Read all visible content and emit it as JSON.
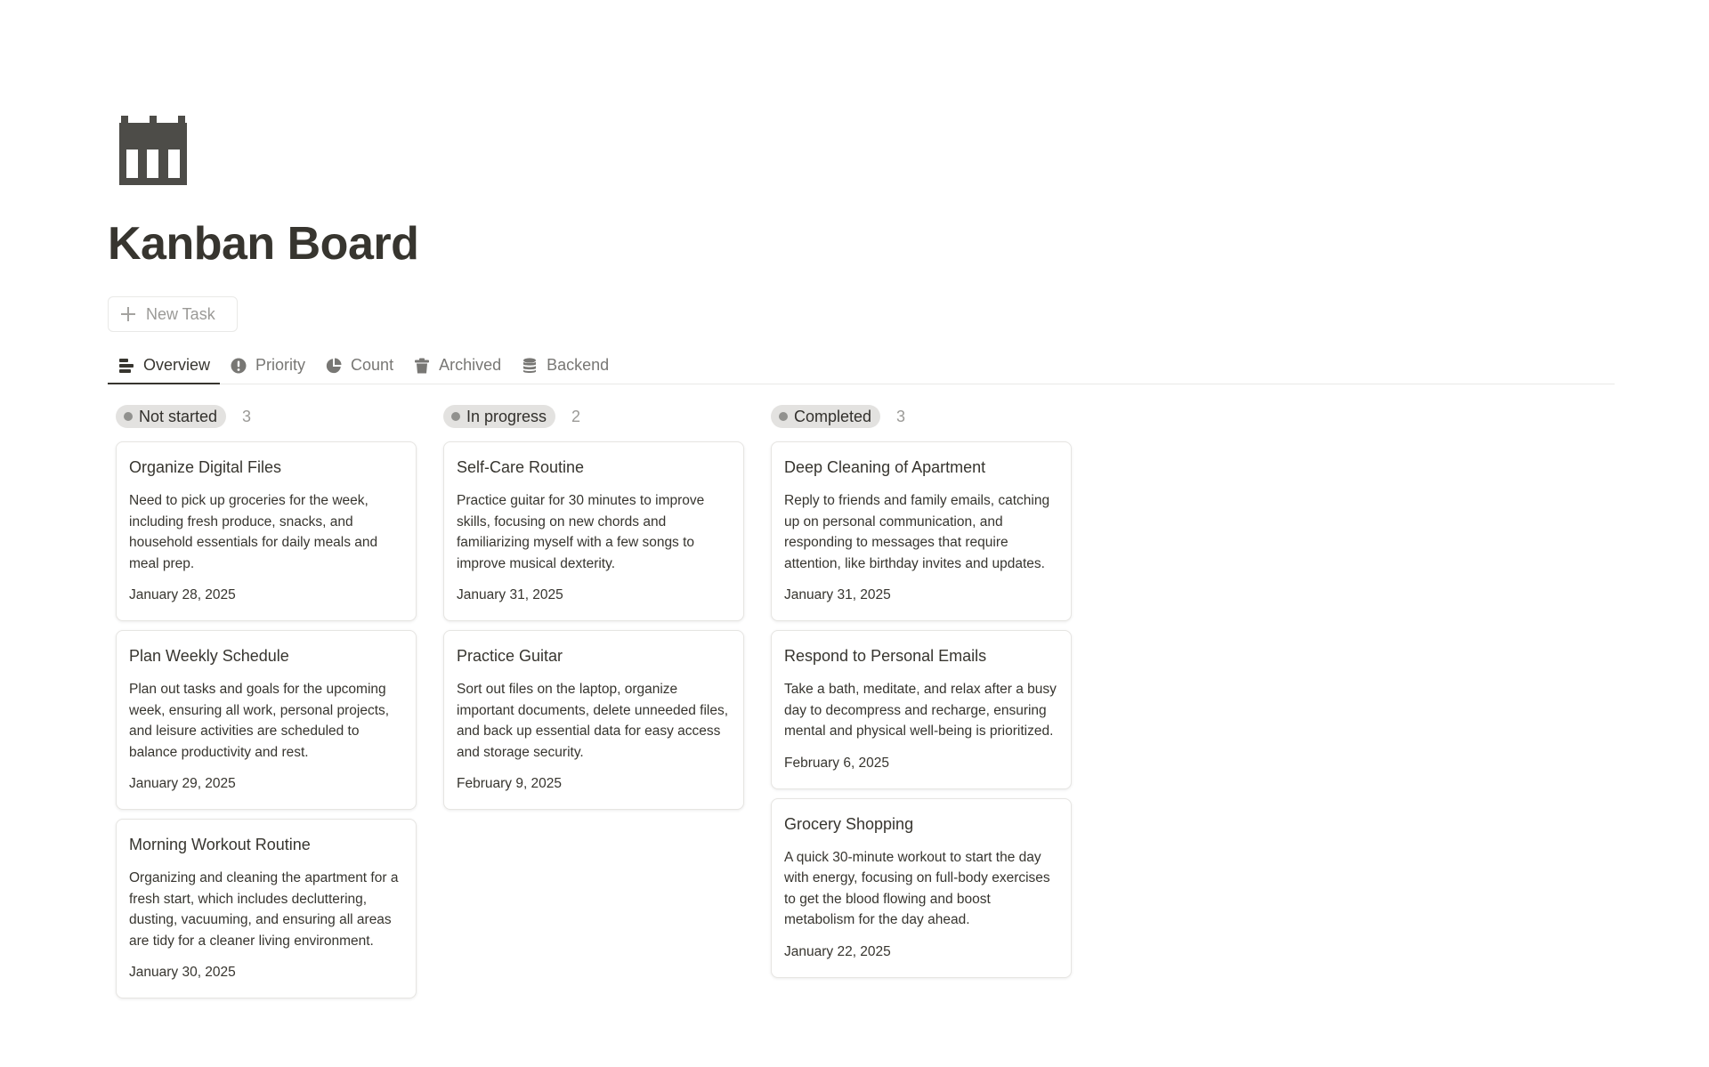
{
  "page": {
    "title": "Kanban Board",
    "icon": "calendar-icon"
  },
  "toolbar": {
    "new_task_label": "New Task"
  },
  "tabs": [
    {
      "label": "Overview",
      "icon": "list-layout-icon",
      "active": true
    },
    {
      "label": "Priority",
      "icon": "alert-circle-icon",
      "active": false
    },
    {
      "label": "Count",
      "icon": "pie-chart-icon",
      "active": false
    },
    {
      "label": "Archived",
      "icon": "trash-icon",
      "active": false
    },
    {
      "label": "Backend",
      "icon": "database-icon",
      "active": false
    }
  ],
  "columns": [
    {
      "status": "Not started",
      "count": "3",
      "cards": [
        {
          "title": "Organize Digital Files",
          "description": "Need to pick up groceries for the week, including fresh produce, snacks, and household essentials for daily meals and meal prep.",
          "date": "January 28, 2025"
        },
        {
          "title": "Plan Weekly Schedule",
          "description": "Plan out tasks and goals for the upcoming week, ensuring all work, personal projects, and leisure activities are scheduled to balance productivity and rest.",
          "date": "January 29, 2025"
        },
        {
          "title": "Morning Workout Routine",
          "description": "Organizing and cleaning the apartment for a fresh start, which includes decluttering, dusting, vacuuming, and ensuring all areas are tidy for a cleaner living environment.",
          "date": "January 30, 2025"
        }
      ]
    },
    {
      "status": "In progress",
      "count": "2",
      "cards": [
        {
          "title": "Self-Care Routine",
          "description": "Practice guitar for 30 minutes to improve skills, focusing on new chords and familiarizing myself with a few songs to improve musical dexterity.",
          "date": "January 31, 2025"
        },
        {
          "title": "Practice Guitar",
          "description": "Sort out files on the laptop, organize important documents, delete unneeded files, and back up essential data for easy access and storage security.",
          "date": "February 9, 2025"
        }
      ]
    },
    {
      "status": "Completed",
      "count": "3",
      "cards": [
        {
          "title": "Deep Cleaning of Apartment",
          "description": "Reply to friends and family emails, catching up on personal communication, and responding to messages that require attention, like birthday invites and updates.",
          "date": "January 31, 2025"
        },
        {
          "title": "Respond to Personal Emails",
          "description": "Take a bath, meditate, and relax after a busy day to decompress and recharge, ensuring mental and physical well-being is prioritized.",
          "date": "February 6, 2025"
        },
        {
          "title": "Grocery Shopping",
          "description": "A quick 30-minute workout to start the day with energy, focusing on full-body exercises to get the blood flowing and boost metabolism for the day ahead.",
          "date": "January 22, 2025"
        }
      ]
    }
  ],
  "colors": {
    "text": "#37352f",
    "muted": "#9b9a97",
    "status_pill_bg": "#e3e2e0",
    "status_dot": "#91918e",
    "divider": "#e9e9e7"
  }
}
